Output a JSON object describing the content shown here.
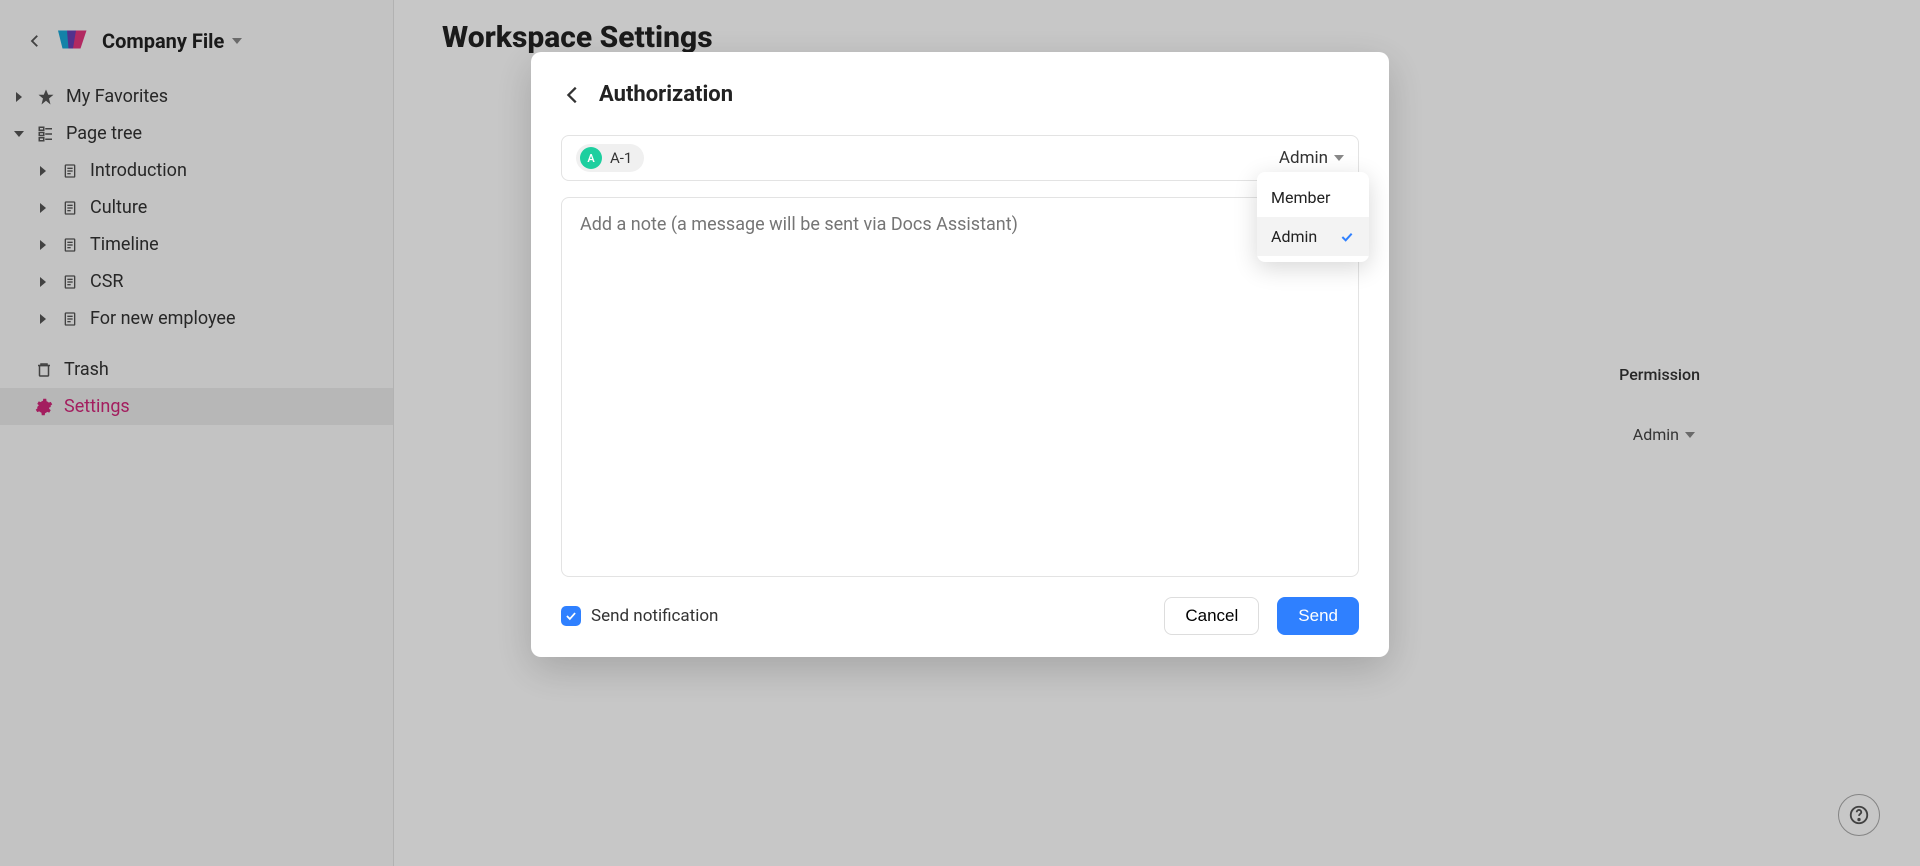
{
  "workspace": {
    "name": "Company File"
  },
  "sidebar": {
    "favorites_label": "My Favorites",
    "page_tree_label": "Page tree",
    "pages": [
      {
        "label": "Introduction"
      },
      {
        "label": "Culture"
      },
      {
        "label": "Timeline"
      },
      {
        "label": "CSR"
      },
      {
        "label": "For new employee"
      }
    ],
    "trash_label": "Trash",
    "settings_label": "Settings"
  },
  "page": {
    "title": "Workspace Settings",
    "permission_header": "Permission",
    "permission_value": "Admin"
  },
  "modal": {
    "title": "Authorization",
    "recipient_chip": {
      "avatar_initial": "A",
      "label": "A-1"
    },
    "role_selected": "Admin",
    "role_options": [
      {
        "label": "Member",
        "selected": false
      },
      {
        "label": "Admin",
        "selected": true
      }
    ],
    "note_placeholder": "Add a note (a message will be sent via Docs Assistant)",
    "send_notification_label": "Send notification",
    "send_notification_checked": true,
    "cancel_label": "Cancel",
    "send_label": "Send"
  }
}
